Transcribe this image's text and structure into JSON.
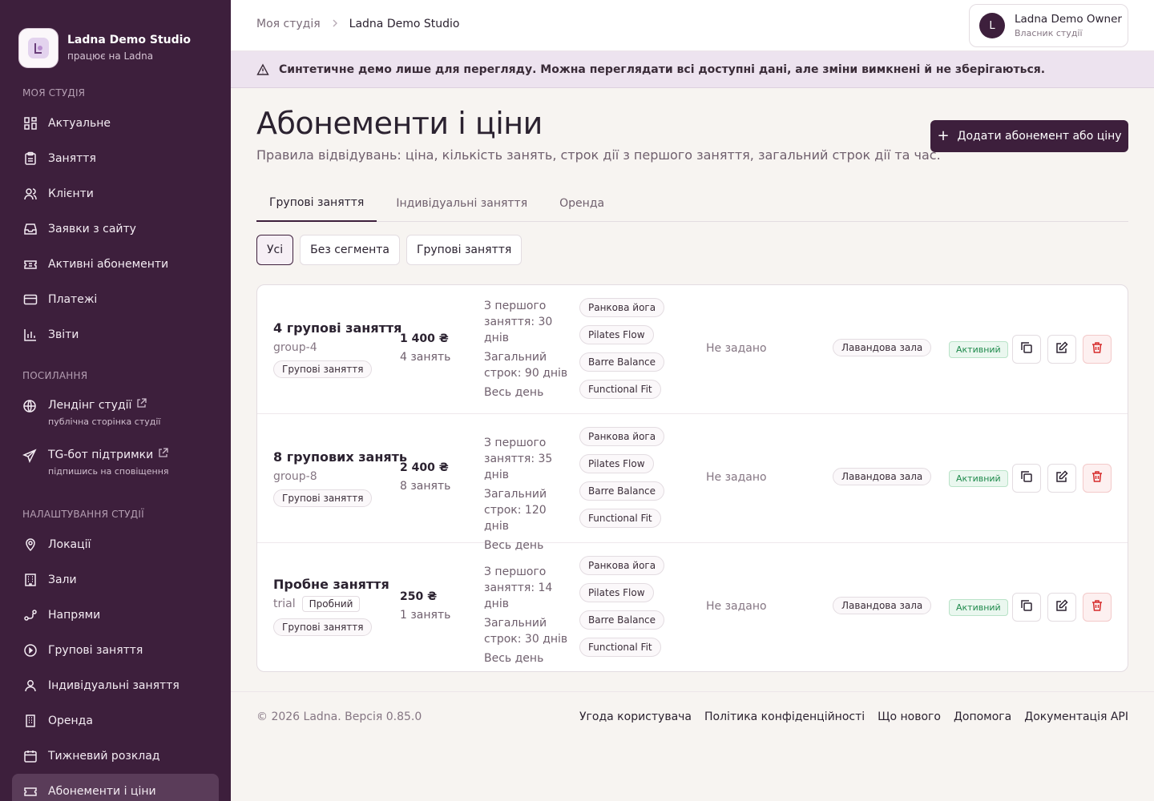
{
  "brand": {
    "name": "Ladna Demo Studio",
    "subtitle": "працює на Ladna"
  },
  "sidebar": {
    "section_studio": "МОЯ СТУДІЯ",
    "studio_items": [
      {
        "label": "Актуальне"
      },
      {
        "label": "Заняття"
      },
      {
        "label": "Клієнти"
      },
      {
        "label": "Заявки з сайту"
      },
      {
        "label": "Активні абонементи"
      },
      {
        "label": "Платежі"
      },
      {
        "label": "Звіти"
      }
    ],
    "section_links": "ПОСИЛАННЯ",
    "links": [
      {
        "label": "Лендінг студії",
        "sub": "публічна сторінка студії"
      },
      {
        "label": "TG-бот підтримки",
        "sub": "підпишись на сповіщення"
      }
    ],
    "section_settings": "НАЛАШТУВАННЯ СТУДІЇ",
    "settings_items": [
      {
        "label": "Локації"
      },
      {
        "label": "Зали"
      },
      {
        "label": "Напрями"
      },
      {
        "label": "Групові заняття"
      },
      {
        "label": "Індивідуальні заняття"
      },
      {
        "label": "Оренда"
      },
      {
        "label": "Тижневий розклад"
      },
      {
        "label": "Абонементи і ціни"
      }
    ]
  },
  "header": {
    "breadcrumb": [
      "Моя студія",
      "Ladna Demo Studio"
    ],
    "user": {
      "initial": "L",
      "name": "Ladna Demo Owner",
      "role": "Власник студії"
    }
  },
  "banner": "Синтетичне демо лише для перегляду. Можна переглядати всі доступні дані, але зміни вимкнені й не зберігаються.",
  "page": {
    "title": "Абонементи і ціни",
    "subtitle": "Правила відвідувань: ціна, кількість занять, строк дії з першого заняття, загальний строк дії та час.",
    "add_button": "Додати абонемент або ціну",
    "tabs": [
      "Групові заняття",
      "Індивідуальні заняття",
      "Оренда"
    ],
    "segments": [
      "Усі",
      "Без сегмента",
      "Групові заняття"
    ]
  },
  "rows": [
    {
      "name": "4 групові заняття",
      "slug": "group-4",
      "badge": "",
      "category": "Групові заняття",
      "price": "1 400 ₴",
      "count": "4 занять",
      "rule1": "З першого заняття: 30 днів",
      "rule2": "Загальний строк: 90 днів",
      "time": "Весь день",
      "directions": [
        "Ранкова йога",
        "Pilates Flow",
        "Barre Balance",
        "Functional Fit"
      ],
      "limit": "Не задано",
      "room": "Лавандова зала",
      "status": "Активний"
    },
    {
      "name": "8 групових занять",
      "slug": "group-8",
      "badge": "",
      "category": "Групові заняття",
      "price": "2 400 ₴",
      "count": "8 занять",
      "rule1": "З першого заняття: 35 днів",
      "rule2": "Загальний строк: 120 днів",
      "time": "Весь день",
      "directions": [
        "Ранкова йога",
        "Pilates Flow",
        "Barre Balance",
        "Functional Fit"
      ],
      "limit": "Не задано",
      "room": "Лавандова зала",
      "status": "Активний"
    },
    {
      "name": "Пробне заняття",
      "slug": "trial",
      "badge": "Пробний",
      "category": "Групові заняття",
      "price": "250 ₴",
      "count": "1 занять",
      "rule1": "З першого заняття: 14 днів",
      "rule2": "Загальний строк: 30 днів",
      "time": "Весь день",
      "directions": [
        "Ранкова йога",
        "Pilates Flow",
        "Barre Balance",
        "Functional Fit"
      ],
      "limit": "Не задано",
      "room": "Лавандова зала",
      "status": "Активний"
    }
  ],
  "footer": {
    "copyright": "© 2026 Ladna. Версія 0.85.0",
    "links": [
      "Угода користувача",
      "Політика конфіденційності",
      "Що нового",
      "Допомога",
      "Документація API"
    ]
  }
}
